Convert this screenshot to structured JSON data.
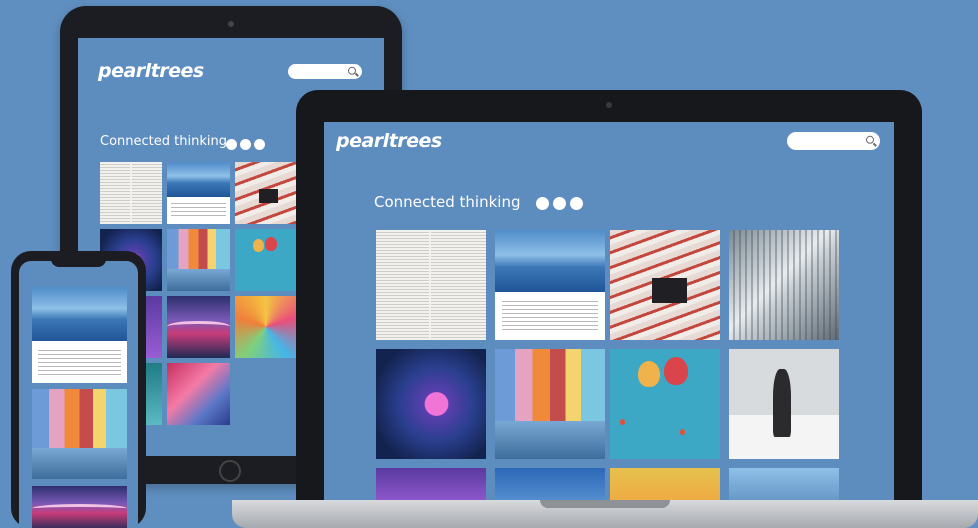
{
  "brand": {
    "name": "pearltrees"
  },
  "tagline": "Connected thinking",
  "search": {
    "placeholder": ""
  },
  "colors": {
    "background": "#5f8fc1",
    "screen": "#5d8cbf",
    "device_frame": "#1b1d22"
  },
  "tiles": [
    {
      "id": "newspaper",
      "kind": "image"
    },
    {
      "id": "mountains-note",
      "kind": "note"
    },
    {
      "id": "red-architecture",
      "kind": "image"
    },
    {
      "id": "library-spiral",
      "kind": "image"
    },
    {
      "id": "pink-lotus",
      "kind": "image"
    },
    {
      "id": "burano-canal",
      "kind": "image"
    },
    {
      "id": "hot-air-balloons",
      "kind": "image"
    },
    {
      "id": "dancer",
      "kind": "image"
    }
  ]
}
